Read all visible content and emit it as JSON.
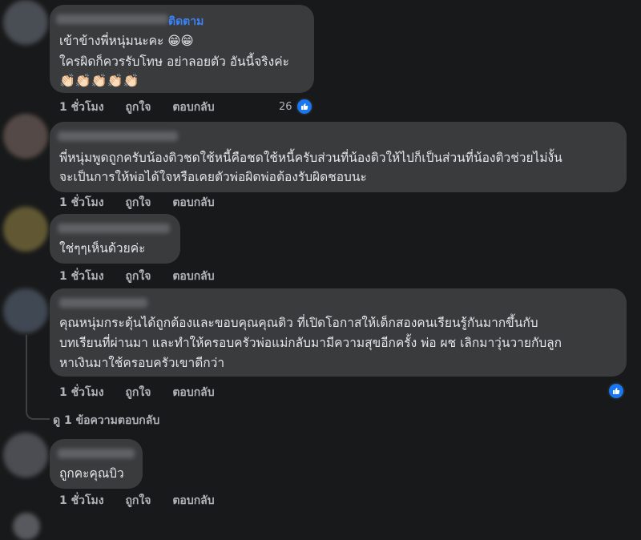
{
  "comments": [
    {
      "follow_label": "ติดตาม",
      "lines": [
        "เข้าข้างพี่หนุ่มนะคะ 😁😁",
        "ใครผิดก็ควรรับโทษ อย่าลอยตัว อันนี้จริงค่ะ",
        "👏🏻👏🏻👏🏻👏🏻👏🏻"
      ],
      "time": "1 ชั่วโมง",
      "like": "ถูกใจ",
      "reply": "ตอบกลับ",
      "like_count": "26"
    },
    {
      "lines": [
        "พี่หนุ่มพูดถูกครับน้องติวชดใช้หนี้คือชดใช้หนี้ครับส่วนที่น้องติวให้ไปก็เป็นส่วนที่น้องติวช่วยไม่งั้น",
        "จะเป็นการให้พ่อได้ใจหรือเคยตัวพ่อผิดพ่อต้องรับผิดชอบนะ"
      ],
      "time": "1 ชั่วโมง",
      "like": "ถูกใจ",
      "reply": "ตอบกลับ"
    },
    {
      "lines": [
        "ใช่ๆๆเห็นด้วยค่ะ"
      ],
      "time": "1 ชั่วโมง",
      "like": "ถูกใจ",
      "reply": "ตอบกลับ"
    },
    {
      "lines": [
        "คุณหนุ่มกระตุ้นได้ถูกต้องและขอบคุณคุณติว ที่เปิดโอกาสให้เด็กสองคนเรียนรู้กันมากขึ้นกับ",
        "บทเรียนที่ผ่านมา และทำให้ครอบครัวพ่อแม่กลับมามีความสุขอีกครั้ง พ่อ ผช เลิกมาวุ่นวายกับลูก",
        "หาเงินมาใช้ครอบครัวเขาดีกว่า"
      ],
      "time": "1 ชั่วโมง",
      "like": "ถูกใจ",
      "reply": "ตอบกลับ",
      "view_replies": "ดู 1 ข้อความตอบกลับ"
    },
    {
      "lines": [
        "ถูกคะคุณบิว"
      ],
      "time": "1 ชั่วโมง",
      "like": "ถูกใจ",
      "reply": "ตอบกลับ"
    }
  ],
  "colors": {
    "background": "#18191a",
    "bubble": "#3a3b3c",
    "accent": "#1877f2",
    "meta_text": "#b0b3b8"
  }
}
